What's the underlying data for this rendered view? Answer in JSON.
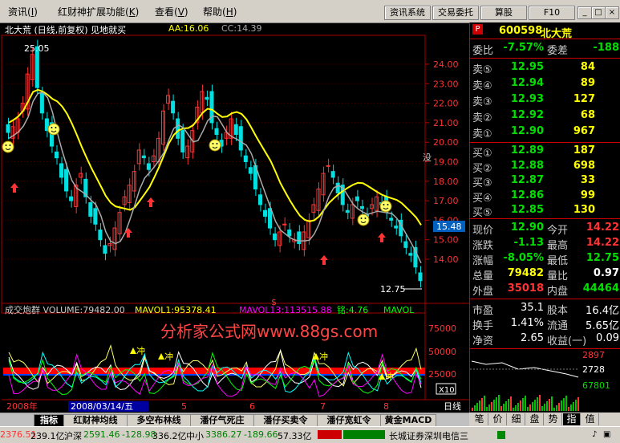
{
  "menu": {
    "items": [
      {
        "label": "资讯",
        "key": "I"
      },
      {
        "label": "红财神扩展功能",
        "key": "K"
      },
      {
        "label": "查看",
        "key": "V"
      },
      {
        "label": "帮助",
        "key": "H"
      }
    ],
    "buttons": [
      "资讯系统",
      "交易委托",
      "算股",
      "F10"
    ],
    "win_buttons": [
      "_",
      "□",
      "×"
    ]
  },
  "chart_header": {
    "title": "北大荒 (日线,前复权) 见地就买",
    "aa": "AA:16.06",
    "cc": "CC:14.39"
  },
  "chart_data": {
    "type": "candlestick",
    "y_ticks": [
      "24.00",
      "23.00",
      "22.00",
      "21.00",
      "20.00",
      "19.00",
      "18.00",
      "17.00",
      "16.00",
      "15.00",
      "14.00"
    ],
    "ylim": [
      13.5,
      24.5
    ],
    "x_labels": [
      "2008年",
      "5",
      "6",
      "7",
      "8"
    ],
    "high_label": "25.05",
    "low_label": "12.75",
    "current_tag": "15.48",
    "buy_marker": "没",
    "volume_header": {
      "name": "成交炮群 VOLUME:79482.00",
      "mavol1": "MAVOL1:95378.41",
      "mavol13": "MAVOL13:113515.88",
      "ming": "铭:4.76",
      "mavol": "MAVOL"
    },
    "vol_ticks": [
      "75000",
      "50000",
      "25000"
    ],
    "vol_unit": "X10",
    "x_cursor_date": "2008/03/14/五",
    "period": "日线",
    "watermark": "分析家公式网www.88gs.com",
    "indicator_labels": [
      "冲",
      "冲",
      "冲",
      "冲"
    ]
  },
  "quote": {
    "code": "600598",
    "name": "北大荒",
    "tag": "P",
    "wei_bi": {
      "label": "委比",
      "value": "-7.57%"
    },
    "wei_cha": {
      "label": "委差",
      "value": "-188"
    },
    "sell": [
      {
        "label": "卖⑤",
        "price": "12.95",
        "vol": "84"
      },
      {
        "label": "卖④",
        "price": "12.94",
        "vol": "89"
      },
      {
        "label": "卖③",
        "price": "12.93",
        "vol": "127"
      },
      {
        "label": "卖②",
        "price": "12.92",
        "vol": "68"
      },
      {
        "label": "卖①",
        "price": "12.90",
        "vol": "967"
      }
    ],
    "buy": [
      {
        "label": "买①",
        "price": "12.89",
        "vol": "187"
      },
      {
        "label": "买②",
        "price": "12.88",
        "vol": "698"
      },
      {
        "label": "买③",
        "price": "12.87",
        "vol": "33"
      },
      {
        "label": "买④",
        "price": "12.86",
        "vol": "99"
      },
      {
        "label": "买⑤",
        "price": "12.85",
        "vol": "130"
      }
    ],
    "stats1": [
      {
        "l1": "现价",
        "v1": "12.90",
        "c1": "#00e000",
        "l2": "今开",
        "v2": "14.22",
        "c2": "#ff3333"
      },
      {
        "l1": "涨跌",
        "v1": "-1.13",
        "c1": "#00e000",
        "l2": "最高",
        "v2": "14.22",
        "c2": "#ff3333"
      },
      {
        "l1": "涨幅",
        "v1": "-8.05%",
        "c1": "#00e000",
        "l2": "最低",
        "v2": "12.75",
        "c2": "#00e000"
      },
      {
        "l1": "总量",
        "v1": "79482",
        "c1": "#ffff00",
        "l2": "量比",
        "v2": "0.97",
        "c2": "#fff"
      },
      {
        "l1": "外盘",
        "v1": "35018",
        "c1": "#ff3333",
        "l2": "内盘",
        "v2": "44464",
        "c2": "#00e000"
      }
    ],
    "stats2": [
      {
        "l1": "市盈",
        "v1": "35.1",
        "l2": "股本",
        "v2": "16.4亿"
      },
      {
        "l1": "换手",
        "v1": "1.41%",
        "l2": "流通",
        "v2": "5.65亿"
      },
      {
        "l1": "净资",
        "v1": "2.65",
        "l2": "收益(一)",
        "v2": "0.09"
      }
    ],
    "mini": {
      "top": "2897",
      "mid": "2728",
      "bot": "67801"
    }
  },
  "tabs": [
    "指标",
    "红财神均线",
    "多空布林线",
    "潘仔气死庄",
    "潘仔买卖令",
    "潘仔宽虹令",
    "黄金MACD"
  ],
  "right_tabs": [
    "笔",
    "价",
    "细",
    "盘",
    "势",
    "指",
    "值"
  ],
  "status": {
    "sh": "2376.51",
    "sh_amt": "239.1亿",
    "sz_label": "沪深",
    "sz": "2591.46",
    "sz_chg": "-128.98",
    "sz_amt": "336.2亿",
    "zx_label": "中小",
    "zx": "3386.27",
    "zx_chg": "-189.66",
    "zx_amt": "57.33亿",
    "broker": "长城证券深圳电信三"
  },
  "colors": {
    "up": "#ff3333",
    "down": "#00e0e0",
    "ma_yellow": "#ffff00",
    "ma_gray": "#aaaaaa"
  }
}
